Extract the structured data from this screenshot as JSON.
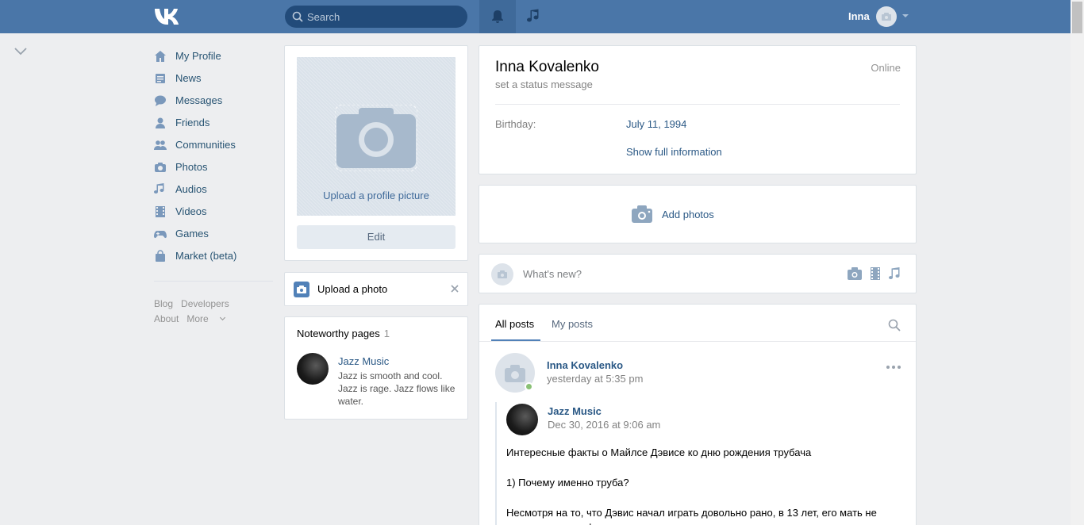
{
  "header": {
    "search_placeholder": "Search",
    "user_name": "Inna"
  },
  "leftnav": {
    "items": [
      {
        "label": "My Profile",
        "icon": "home-icon"
      },
      {
        "label": "News",
        "icon": "news-icon"
      },
      {
        "label": "Messages",
        "icon": "messages-icon"
      },
      {
        "label": "Friends",
        "icon": "friend-icon"
      },
      {
        "label": "Communities",
        "icon": "communities-icon"
      },
      {
        "label": "Photos",
        "icon": "camera-icon"
      },
      {
        "label": "Audios",
        "icon": "music-icon"
      },
      {
        "label": "Videos",
        "icon": "film-icon"
      },
      {
        "label": "Games",
        "icon": "gamepad-icon"
      },
      {
        "label": "Market (beta)",
        "icon": "bag-icon"
      }
    ],
    "footer": {
      "blog": "Blog",
      "developers": "Developers",
      "about": "About",
      "more": "More"
    }
  },
  "profile_photo": {
    "upload_label": "Upload a profile picture",
    "edit_label": "Edit"
  },
  "upload_photo": {
    "label": "Upload a photo"
  },
  "noteworthy": {
    "title": "Noteworthy pages",
    "count": "1",
    "page_name": "Jazz Music",
    "page_desc": "Jazz is smooth and cool. Jazz is rage. Jazz flows like water."
  },
  "profile": {
    "name": "Inna Kovalenko",
    "status": "set a status message",
    "online": "Online",
    "birthday_label": "Birthday:",
    "birthday_value": "July 11, 1994",
    "show_full": "Show full information"
  },
  "add_photos": {
    "label": "Add photos"
  },
  "whats_new": {
    "placeholder": "What's new?"
  },
  "wall": {
    "tabs": [
      "All posts",
      "My posts"
    ],
    "post": {
      "author": "Inna Kovalenko",
      "time": "yesterday at 5:35 pm",
      "repost_name": "Jazz Music",
      "repost_time": "Dec 30, 2016 at 9:06 am",
      "paragraphs": [
        "Интересные факты о Майлсе Дэвисе ко дню рождения трубача",
        "1) Почему именно труба?",
        "Несмотря на то, что Дэвис начал играть довольно рано, в 13 лет, его мать не позволяла ему официально вступить в местную музыкальную группу до тех"
      ]
    }
  },
  "colors": {
    "header_bg": "#4a76a8",
    "link": "#2a5885",
    "page_bg": "#edeef0"
  }
}
